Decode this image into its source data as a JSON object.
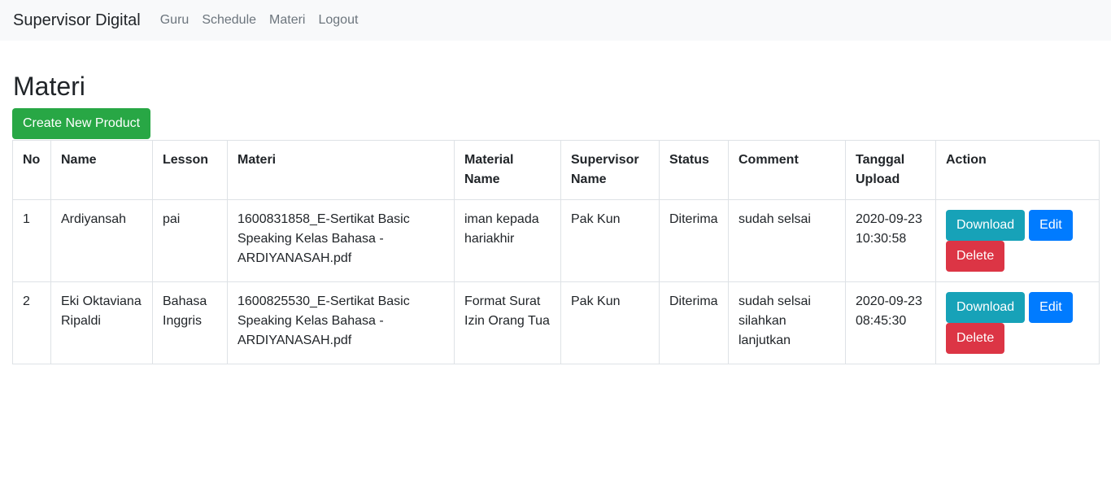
{
  "navbar": {
    "brand": "Supervisor Digital",
    "links": [
      "Guru",
      "Schedule",
      "Materi",
      "Logout"
    ]
  },
  "page": {
    "title": "Materi",
    "create_button": "Create New Product"
  },
  "table": {
    "headers": [
      "No",
      "Name",
      "Lesson",
      "Materi",
      "Material Name",
      "Supervisor Name",
      "Status",
      "Comment",
      "Tanggal Upload",
      "Action"
    ],
    "rows": [
      {
        "no": "1",
        "name": "Ardiyansah",
        "lesson": "pai",
        "materi": "1600831858_E-Sertikat Basic Speaking Kelas Bahasa - ARDIYANASAH.pdf",
        "material_name": "iman kepada hariakhir",
        "supervisor": "Pak Kun",
        "status": "Diterima",
        "comment": "sudah selsai",
        "tanggal": "2020-09-23 10:30:58"
      },
      {
        "no": "2",
        "name": "Eki Oktaviana Ripaldi",
        "lesson": "Bahasa Inggris",
        "materi": "1600825530_E-Sertikat Basic Speaking Kelas Bahasa - ARDIYANASAH.pdf",
        "material_name": "Format Surat Izin Orang Tua",
        "supervisor": "Pak Kun",
        "status": "Diterima",
        "comment": "sudah selsai silahkan lanjutkan",
        "tanggal": "2020-09-23 08:45:30"
      }
    ],
    "actions": {
      "download": "Download",
      "edit": "Edit",
      "delete": "Delete"
    }
  },
  "colors": {
    "success": "#28a745",
    "info": "#17a2b8",
    "primary": "#007bff",
    "danger": "#dc3545",
    "navbar_bg": "#f8f9fa"
  }
}
